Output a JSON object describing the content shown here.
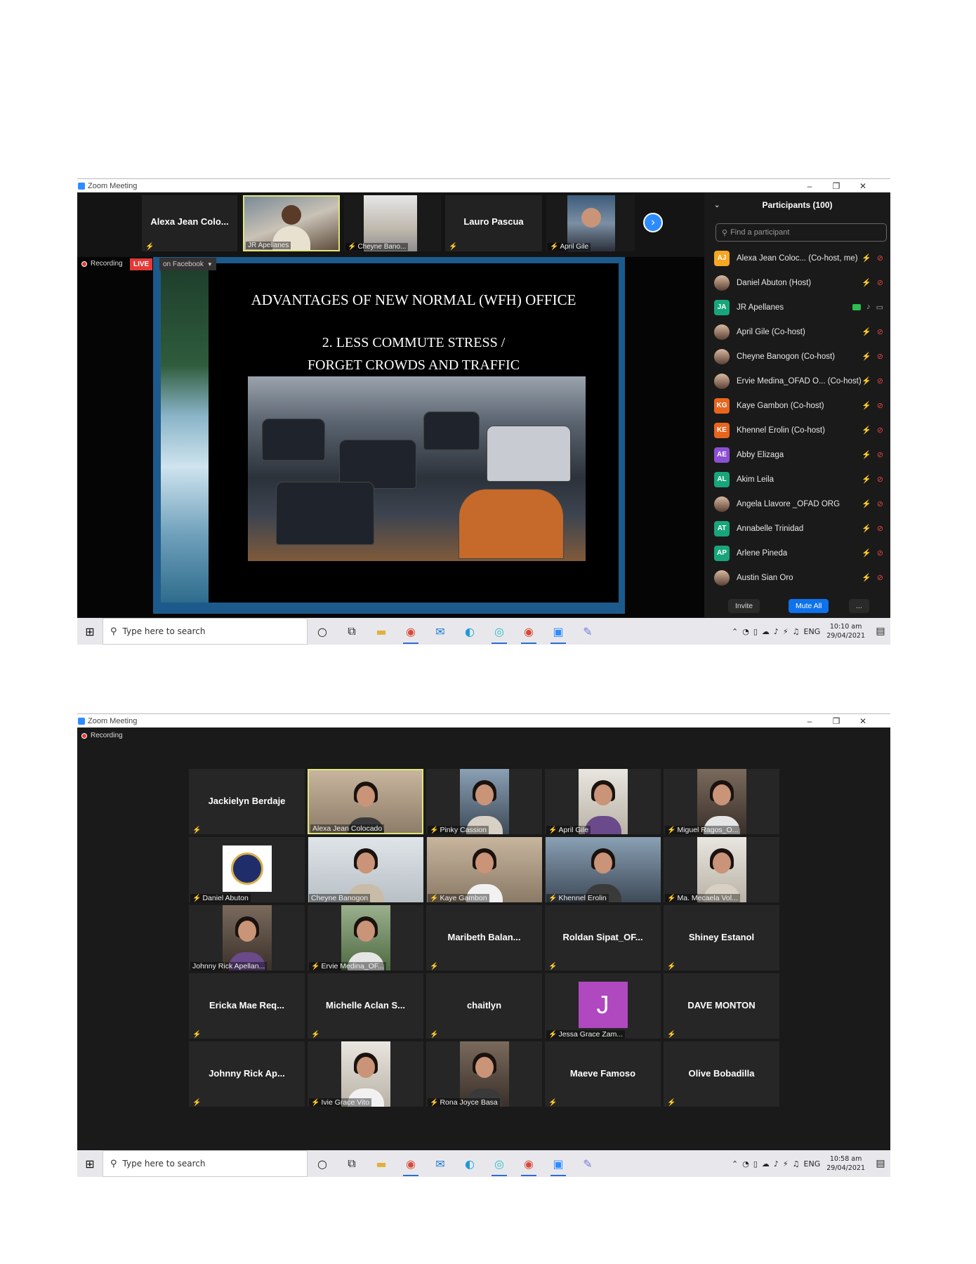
{
  "shot1": {
    "window_title": "Zoom Meeting",
    "strip": [
      {
        "name": "Alexa Jean Colo...",
        "kind": "name"
      },
      {
        "label": "JR Apellanes",
        "kind": "video"
      },
      {
        "label": "Cheyne Bano...",
        "kind": "video"
      },
      {
        "name": "Lauro Pascua",
        "kind": "name"
      },
      {
        "label": "April Gile",
        "kind": "video"
      }
    ],
    "recording_label": "Recording",
    "live_label": "LIVE",
    "on_facebook_label": "on Facebook",
    "slide": {
      "title": "ADVANTAGES OF NEW NORMAL (WFH) OFFICE",
      "line1": "2. LESS COMMUTE STRESS /",
      "line2": "FORGET CROWDS AND TRAFFIC"
    },
    "participants": {
      "header": "Participants (100)",
      "search_placeholder": "Find a participant",
      "rows": [
        {
          "initials": "AJ",
          "color": "#f5a623",
          "name": "Alexa Jean Coloc...  (Co-host, me)"
        },
        {
          "initials": "",
          "color": "photo",
          "name": "Daniel Abuton (Host)"
        },
        {
          "initials": "JA",
          "color": "#18a57b",
          "name": "JR Apellanes",
          "speaking": true
        },
        {
          "initials": "",
          "color": "photo",
          "name": "April Gile (Co-host)"
        },
        {
          "initials": "",
          "color": "photo",
          "name": "Cheyne Banogon (Co-host)"
        },
        {
          "initials": "",
          "color": "photo",
          "name": "Ervie Medina_OFAD O...  (Co-host)"
        },
        {
          "initials": "KG",
          "color": "#e8651e",
          "name": "Kaye Gambon (Co-host)"
        },
        {
          "initials": "KE",
          "color": "#e8651e",
          "name": "Khennel Erolin (Co-host)"
        },
        {
          "initials": "AE",
          "color": "#8b4fd1",
          "name": "Abby Elizaga"
        },
        {
          "initials": "AL",
          "color": "#18a57b",
          "name": "Akim Leila"
        },
        {
          "initials": "",
          "color": "photo",
          "name": "Angela Llavore _OFAD ORG"
        },
        {
          "initials": "AT",
          "color": "#18a57b",
          "name": "Annabelle Trinidad"
        },
        {
          "initials": "AP",
          "color": "#18a57b",
          "name": "Arlene Pineda"
        },
        {
          "initials": "",
          "color": "photo",
          "name": "Austin Sian Oro"
        }
      ],
      "invite": "Invite",
      "mute_all": "Mute All",
      "more": "..."
    },
    "taskbar": {
      "search": "Type here to search",
      "lang": "ENG",
      "time": "10:10 am",
      "date": "29/04/2021"
    }
  },
  "shot2": {
    "window_title": "Zoom Meeting",
    "recording_label": "Recording",
    "tiles": [
      {
        "name": "Jackielyn Berdaje",
        "kind": "name"
      },
      {
        "label": "Alexa Jean Colocado",
        "kind": "video",
        "active": true
      },
      {
        "label": "Pinky Cassion",
        "kind": "video"
      },
      {
        "label": "April Gile",
        "kind": "video"
      },
      {
        "label": "Miguel Ragos_O...",
        "kind": "video"
      },
      {
        "label": "Daniel Abuton",
        "kind": "logo"
      },
      {
        "label": "Cheyne Banogon",
        "kind": "video"
      },
      {
        "label": "Kaye Gambon",
        "kind": "video"
      },
      {
        "label": "Khennel Erolin",
        "kind": "video"
      },
      {
        "label": "Ma. Mecaela Vol...",
        "kind": "video"
      },
      {
        "label": "Johnny Rick Apellan...",
        "kind": "video"
      },
      {
        "label": "Ervie Medina_OF...",
        "kind": "video"
      },
      {
        "name": "Maribeth  Balan...",
        "kind": "name"
      },
      {
        "name": "Roldan  Sipat_OF...",
        "kind": "name"
      },
      {
        "name": "Shiney Estanol",
        "kind": "name"
      },
      {
        "name": "Ericka  Mae  Req...",
        "kind": "name"
      },
      {
        "name": "Michelle  Aclan  S...",
        "kind": "name"
      },
      {
        "name": "chaitlyn",
        "kind": "name"
      },
      {
        "label": "Jessa Grace Zam...",
        "kind": "letter",
        "letter": "J"
      },
      {
        "name": "DAVE MONTON",
        "kind": "name"
      },
      {
        "name": "Johnny Rick Ap...",
        "kind": "name"
      },
      {
        "label": "Ivie Grace Vito",
        "kind": "video"
      },
      {
        "label": "Rona Joyce Basa",
        "kind": "video"
      },
      {
        "name": "Maeve Famoso",
        "kind": "name"
      },
      {
        "name": "Olive Bobadilla",
        "kind": "name"
      }
    ],
    "taskbar": {
      "search": "Type here to search",
      "lang": "ENG",
      "time": "10:58 am",
      "date": "29/04/2021"
    }
  }
}
